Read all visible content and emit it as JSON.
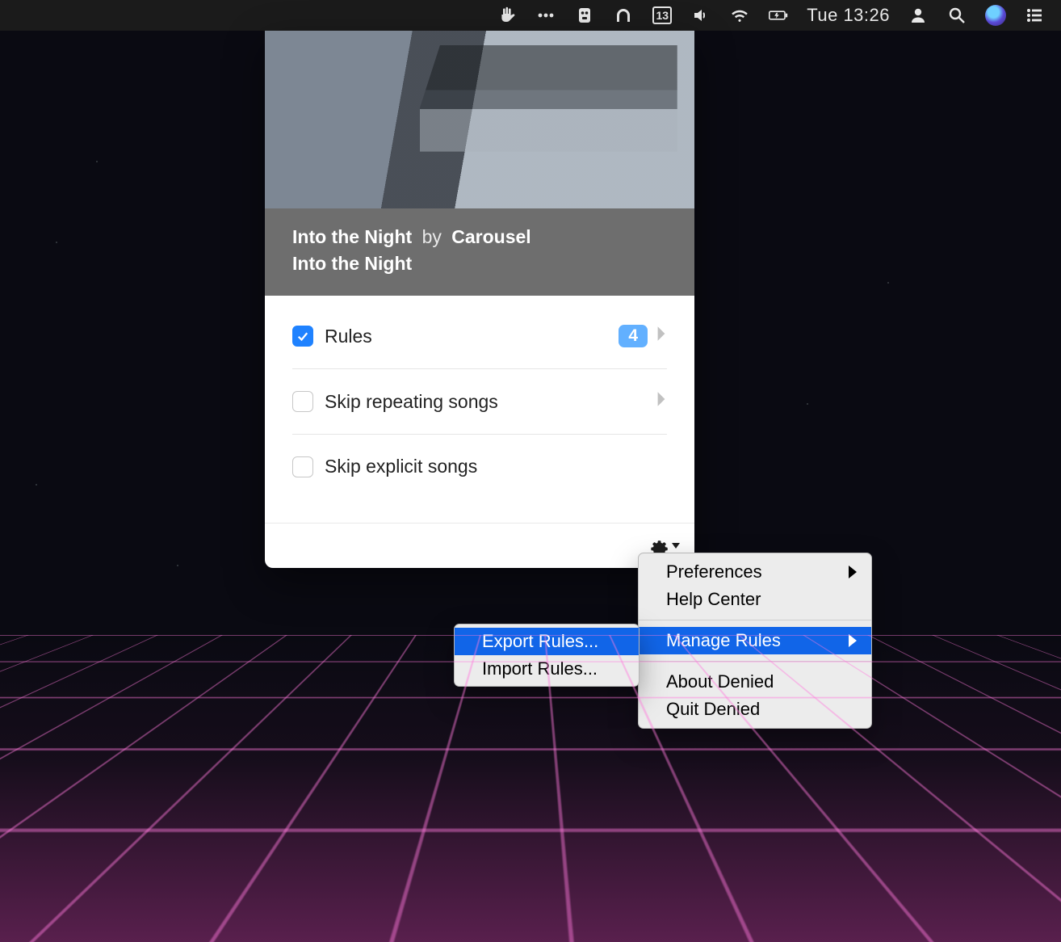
{
  "menubar": {
    "calendar_day": "13",
    "clock": "Tue 13:26"
  },
  "now_playing": {
    "title": "Into the Night",
    "by_label": "by",
    "artist": "Carousel",
    "album": "Into the Night"
  },
  "settings": {
    "rules": {
      "label": "Rules",
      "checked": true,
      "count": "4"
    },
    "skip_repeating": {
      "label": "Skip repeating songs",
      "checked": false
    },
    "skip_explicit": {
      "label": "Skip explicit songs",
      "checked": false
    }
  },
  "context_menu": {
    "preferences": "Preferences",
    "help_center": "Help Center",
    "manage_rules": "Manage Rules",
    "about": "About Denied",
    "quit": "Quit Denied"
  },
  "submenu": {
    "export": "Export Rules...",
    "import": "Import Rules..."
  }
}
